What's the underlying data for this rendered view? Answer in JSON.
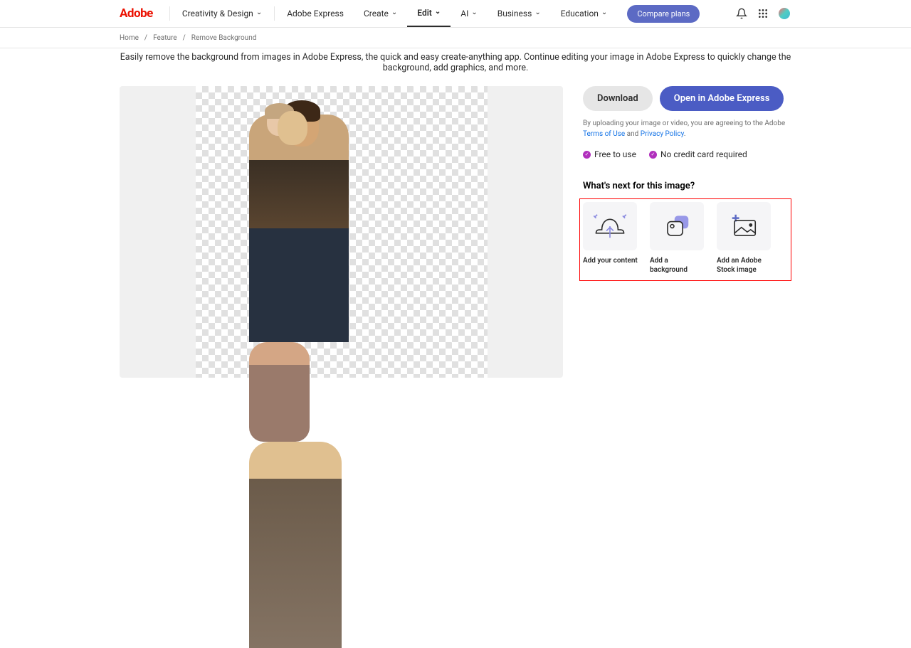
{
  "header": {
    "logo": "Adobe",
    "nav": {
      "creativity": "Creativity & Design",
      "express": "Adobe Express",
      "create": "Create",
      "edit": "Edit",
      "ai": "AI",
      "business": "Business",
      "education": "Education"
    },
    "compare": "Compare plans"
  },
  "breadcrumb": {
    "home": "Home",
    "feature": "Feature",
    "current": "Remove Background"
  },
  "description": "Easily remove the background from images in Adobe Express, the quick and easy create-anything app. Continue editing your image in Adobe Express to quickly change the background, add graphics, and more.",
  "actions": {
    "download": "Download",
    "open": "Open in Adobe Express"
  },
  "terms": {
    "prefix": "By uploading your image or video, you are agreeing to the Adobe ",
    "tou": "Terms of Use",
    "and": " and ",
    "privacy": "Privacy Policy",
    "suffix": "."
  },
  "features": {
    "free": "Free to use",
    "nocard": "No credit card required"
  },
  "next": {
    "title": "What's next for this image?",
    "cards": [
      {
        "label": "Add your content"
      },
      {
        "label": "Add a background"
      },
      {
        "label": "Add an Adobe Stock image"
      }
    ]
  }
}
